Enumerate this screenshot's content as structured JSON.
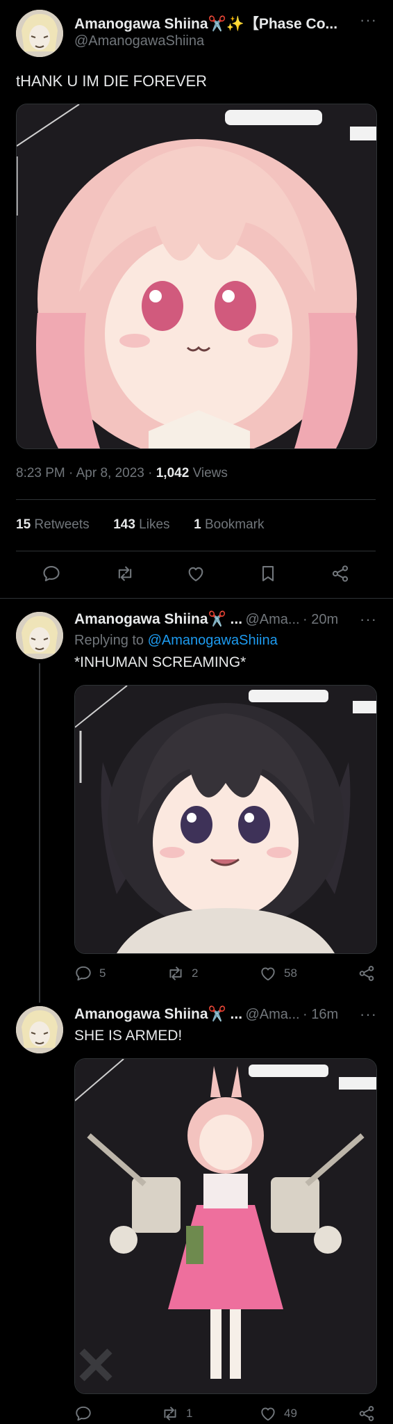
{
  "main_tweet": {
    "display_name": "Amanogawa Shiina✂️✨【Phase Co...",
    "handle": "@AmanogawaShiina",
    "text": "tHANK U IM DIE FOREVER",
    "time": "8:23 PM · Apr 8, 2023 ·",
    "views_count": "1,042",
    "views_label": "Views",
    "retweets_count": "15",
    "retweets_label": "Retweets",
    "likes_count": "143",
    "likes_label": "Likes",
    "bookmarks_count": "1",
    "bookmarks_label": "Bookmark",
    "more_label": "···"
  },
  "replies": [
    {
      "display_name": "Amanogawa Shiina✂️ ...",
      "handle": "@Ama...",
      "age": "· 20m",
      "replying_prefix": "Replying to",
      "replying_handle": "@AmanogawaShiina",
      "text": "*INHUMAN SCREAMING*",
      "reply_count": "5",
      "retweet_count": "2",
      "like_count": "58",
      "more_label": "···"
    },
    {
      "display_name": "Amanogawa Shiina✂️ ...",
      "handle": "@Ama...",
      "age": "· 16m",
      "text": "SHE IS ARMED!",
      "reply_count": "",
      "retweet_count": "1",
      "like_count": "49",
      "more_label": "···"
    }
  ],
  "colors": {
    "background": "#000000",
    "text": "#e7e9ea",
    "muted": "#71767b",
    "link": "#1d9bf0",
    "divider": "#2f3336"
  },
  "icons": [
    "reply-icon",
    "retweet-icon",
    "like-icon",
    "bookmark-icon",
    "share-icon",
    "more-icon"
  ]
}
